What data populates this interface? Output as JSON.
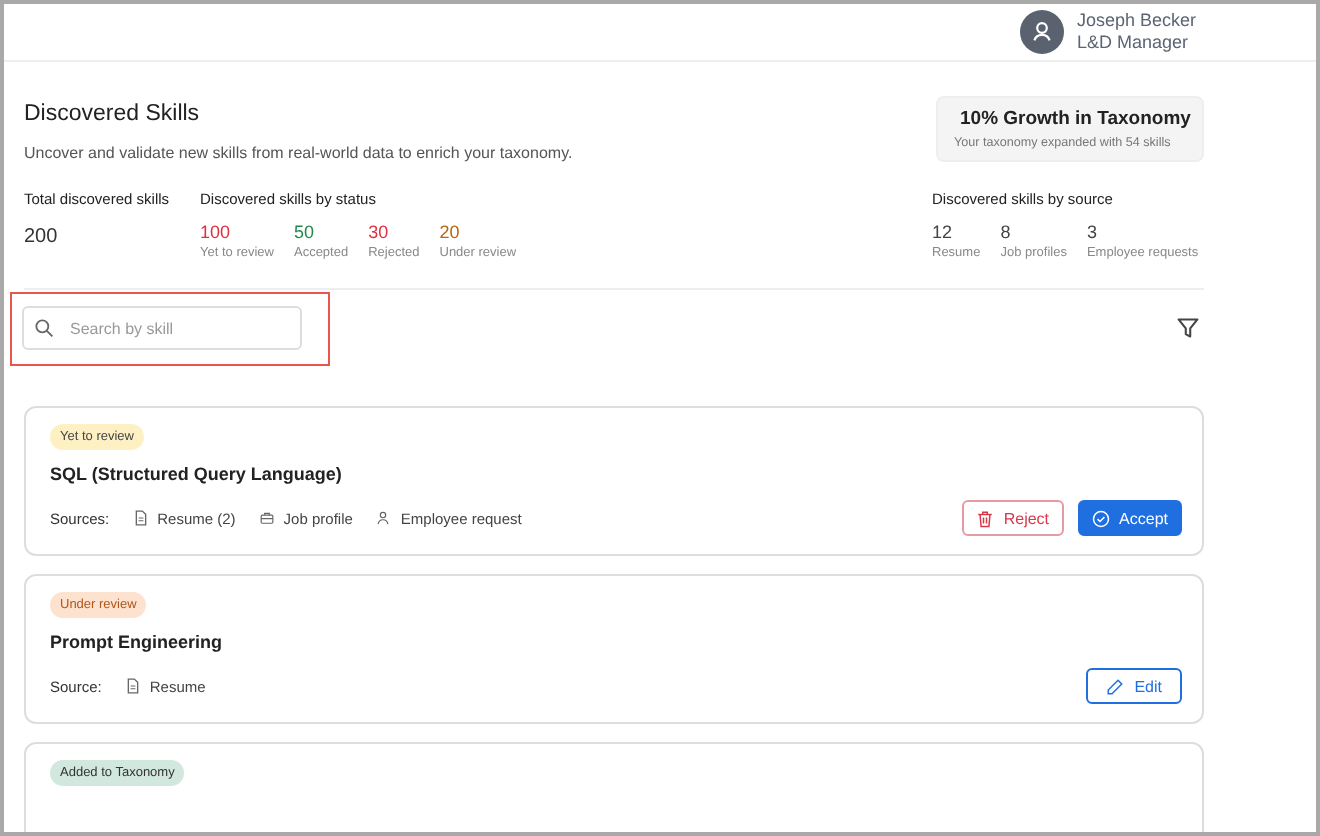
{
  "user": {
    "name": "Joseph Becker",
    "role": "L&D Manager"
  },
  "page": {
    "title": "Discovered Skills",
    "subtitle": "Uncover and validate new skills from real-world data to enrich your taxonomy."
  },
  "growth": {
    "title": "10% Growth in Taxonomy",
    "caption": "Your taxonomy expanded with 54 skills"
  },
  "total": {
    "label": "Total discovered skills",
    "value": "200"
  },
  "by_status": {
    "label": "Discovered skills by status",
    "items": [
      {
        "value": "100",
        "label": "Yet to review",
        "color": "#e0303f"
      },
      {
        "value": "50",
        "label": "Accepted",
        "color": "#1f8a4c"
      },
      {
        "value": "30",
        "label": "Rejected",
        "color": "#e0303f"
      },
      {
        "value": "20",
        "label": "Under review",
        "color": "#b8650f"
      }
    ]
  },
  "by_source": {
    "label": "Discovered skills by source",
    "items": [
      {
        "value": "12",
        "label": "Resume"
      },
      {
        "value": "8",
        "label": "Job profiles"
      },
      {
        "value": "3",
        "label": "Employee requests"
      }
    ]
  },
  "search": {
    "placeholder": "Search by skill",
    "highlighted": true
  },
  "cards": [
    {
      "status": "Yet to review",
      "kind": "pending",
      "title": "SQL (Structured Query Language)",
      "sources_label": "Sources:",
      "sources": [
        {
          "kind": "document",
          "label": "Resume (2)"
        },
        {
          "kind": "briefcase",
          "label": "Job profile"
        },
        {
          "kind": "person",
          "label": "Employee request"
        }
      ],
      "actions": [
        {
          "kind": "reject",
          "label": "Reject"
        },
        {
          "kind": "accept",
          "label": "Accept"
        }
      ]
    },
    {
      "status": "Under review",
      "kind": "review",
      "title": "Prompt Engineering",
      "sources_label": "Source:",
      "sources": [
        {
          "kind": "document",
          "label": "Resume"
        }
      ],
      "actions": [
        {
          "kind": "edit",
          "label": "Edit"
        }
      ]
    },
    {
      "status": "Added to Taxonomy",
      "kind": "added"
    }
  ]
}
